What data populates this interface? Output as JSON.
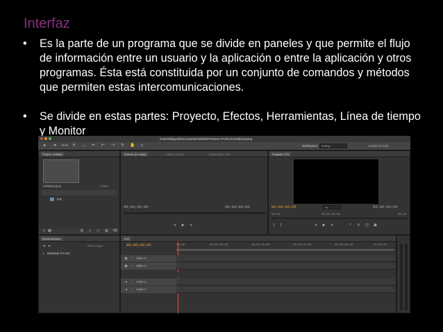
{
  "slide": {
    "title": "Interfaz",
    "bullets": [
      "Es la parte de un programa que se divide en paneles y que permite el flujo de información entre un usuario y la aplicación o entre la aplicación y otros programas. Ésta está constituida por un conjunto de comandos y métodos que permiten estas intercomunicaciones.",
      "Se divide en estas partes: Proyecto, Efectos, Herramientas, Línea de tiempo y  Monitor"
    ],
    "bullet_glyph": "•"
  },
  "app": {
    "path": "/Users/Miguel/Documents/Adobe/Premiere Pro/5.0/Untitled.prproj",
    "workspace_label": "Workspace:",
    "workspace_value": "Editing",
    "cslive": "Access CS Live",
    "project": {
      "tab": "Project: Untitled",
      "item_name": "Untitled.prproj",
      "item_count": "1 Item",
      "sequence": "576"
    },
    "source": {
      "tabs": [
        "Source: (no clips)",
        "Effect Controls",
        "Audio Mixer: 576"
      ],
      "timecode_left": "00;00;00;00",
      "timecode_right": "00;00;00;00"
    },
    "program": {
      "tab": "Program: 576",
      "timecode_left": "00;00;00;05",
      "fit": "Fit",
      "timecode_right": "00;00;00;00",
      "ruler": [
        "00;00",
        "00;05;00;00",
        "00;10"
      ]
    },
    "media_browser": {
      "tab": "Media Browser",
      "files_of_type": "Files of type:",
      "drive": "MacBook Pro HD"
    },
    "timeline": {
      "tab": "576",
      "timecode": "00;00;00;05",
      "ruler": [
        "00;00",
        "00;01;00;00",
        "00;02;00;00",
        "00;03;00;00",
        "00;04;00;00",
        "00;05;00"
      ],
      "tracks": [
        "Video 2",
        "Video 1",
        "Audio 1",
        "Audio 2"
      ]
    }
  }
}
